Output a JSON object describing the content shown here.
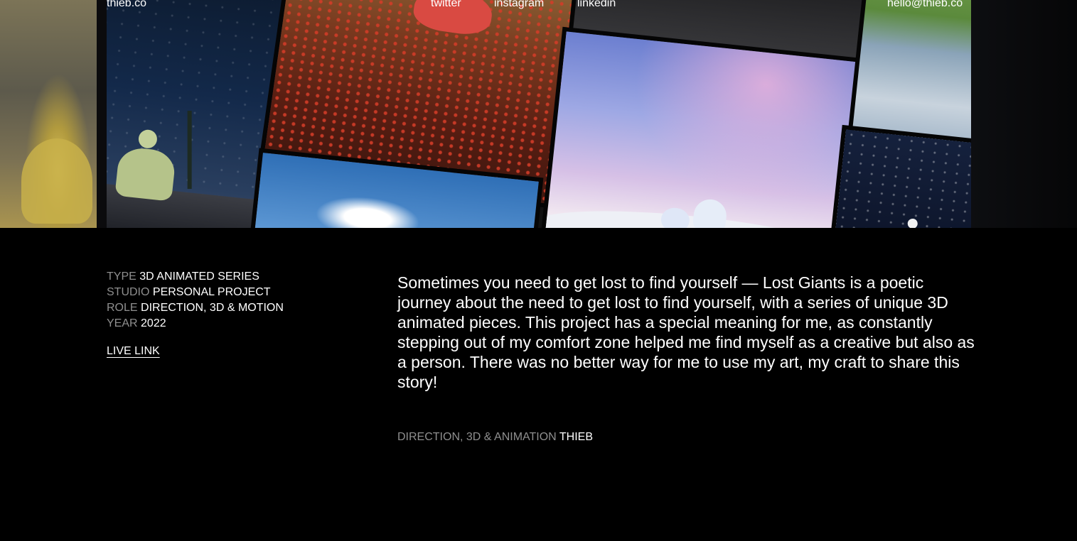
{
  "nav": {
    "logo": "thieb.co",
    "links": [
      "twitter",
      "instagram",
      "linkedin"
    ],
    "email": "hello@thieb.co"
  },
  "hero": {
    "image_description_icon": "lost-giants-collage"
  },
  "meta": {
    "type_label": "TYPE",
    "type_value": "3D ANIMATED SERIES",
    "studio_label": "STUDIO",
    "studio_value": "PERSONAL PROJECT",
    "role_label": "ROLE",
    "role_value": "DIRECTION, 3D & MOTION",
    "year_label": "YEAR",
    "year_value": "2022",
    "live_link": "LIVE LINK"
  },
  "description": "Sometimes you need to get lost to find yourself — Lost Giants is a poetic journey about the need to get lost to find yourself, with a series of unique 3D animated pieces. This project has a special meaning for me, as constantly stepping out of my comfort zone helped me find myself as a creative but also as a person. There was no better way for me to use my art, my craft to share this story!",
  "credits": {
    "label": "DIRECTION, 3D & ANIMATION",
    "name": "THIEB"
  },
  "colors": {
    "background": "#000000",
    "muted": "#8f8f8f",
    "text": "#ffffff"
  }
}
